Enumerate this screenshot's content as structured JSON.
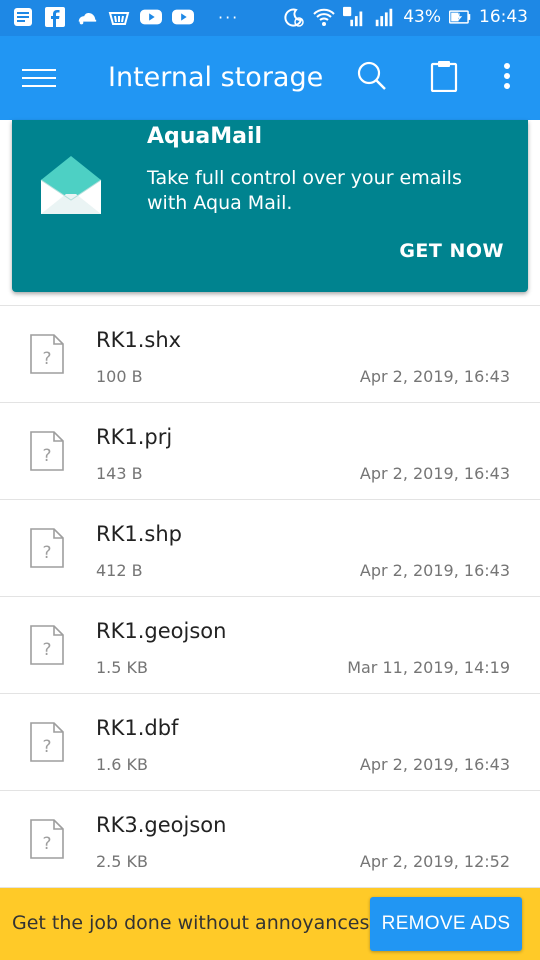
{
  "status_bar": {
    "battery": "43%",
    "time": "16:43",
    "more": "···",
    "left_icons": [
      "notes-icon",
      "facebook-icon",
      "weather-icon",
      "shopping-basket-icon",
      "youtube-icon",
      "youtube-icon"
    ],
    "right_icons": [
      "alarm-icon",
      "wifi-icon",
      "signal-sim1-icon",
      "signal-sim2-icon",
      "battery-charging-icon"
    ]
  },
  "app_bar": {
    "title": "Internal storage",
    "icons": [
      "menu-icon",
      "search-icon",
      "clipboard-icon",
      "more-vert-icon"
    ]
  },
  "ad_card": {
    "title": "AquaMail",
    "description": "Take full control over your emails with Aqua Mail.",
    "cta": "GET NOW",
    "icon": "mail-envelope-icon"
  },
  "files": [
    {
      "name": "RK1.shx",
      "size": "100 B",
      "date": "Apr 2, 2019, 16:43"
    },
    {
      "name": "RK1.prj",
      "size": "143 B",
      "date": "Apr 2, 2019, 16:43"
    },
    {
      "name": "RK1.shp",
      "size": "412 B",
      "date": "Apr 2, 2019, 16:43"
    },
    {
      "name": "RK1.geojson",
      "size": "1.5 KB",
      "date": "Mar 11, 2019, 14:19"
    },
    {
      "name": "RK1.dbf",
      "size": "1.6 KB",
      "date": "Apr 2, 2019, 16:43"
    },
    {
      "name": "RK3.geojson",
      "size": "2.5 KB",
      "date": "Apr 2, 2019, 12:52"
    }
  ],
  "bottom_ad": {
    "text": "Get the job done without annoyances.",
    "button": "REMOVE ADS"
  },
  "colors": {
    "status_bar": "#1E88E5",
    "app_bar": "#2196F3",
    "ad_card": "#00838F",
    "bottom_ad": "#FFCA28"
  }
}
